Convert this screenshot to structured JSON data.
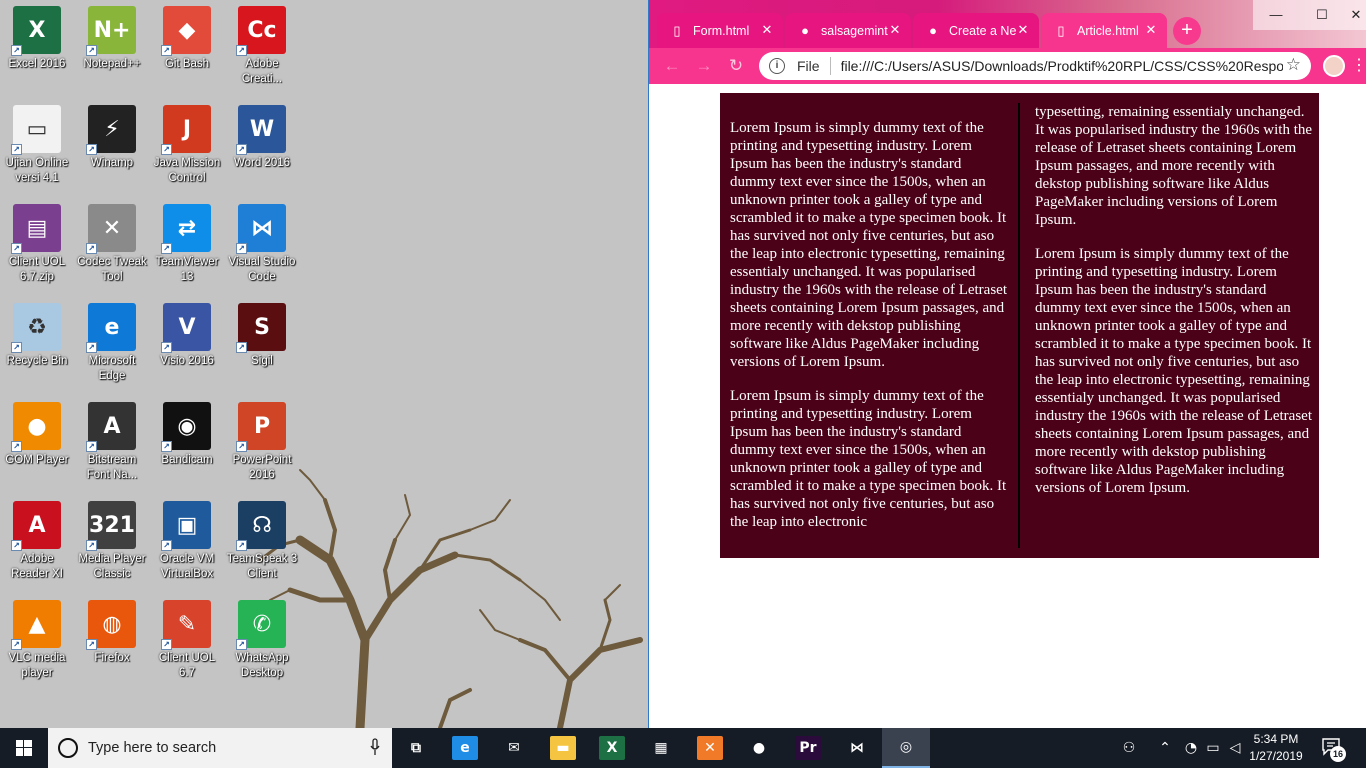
{
  "desktop": {
    "icons": [
      {
        "label": "Excel 2016",
        "glyph": "X",
        "icon": "excel-icon",
        "color": "#1d7044"
      },
      {
        "label": "Notepad++",
        "glyph": "N+",
        "icon": "notepadpp-icon",
        "color": "#89b63a"
      },
      {
        "label": "Git Bash",
        "glyph": "◆",
        "icon": "gitbash-icon",
        "color": "#e24a3a"
      },
      {
        "label": "Adobe Creati...",
        "glyph": "Cc",
        "icon": "adobe-cc-icon",
        "color": "#d7161d"
      },
      {
        "label": "Ujian Online versi 4.1",
        "glyph": "▭",
        "icon": "ujian-online-icon",
        "color": "#f2f2f2"
      },
      {
        "label": "Winamp",
        "glyph": "⚡",
        "icon": "winamp-icon",
        "color": "#222222"
      },
      {
        "label": "Java Mission Control",
        "glyph": "J",
        "icon": "java-mission-control-icon",
        "color": "#d23a20"
      },
      {
        "label": "Word 2016",
        "glyph": "W",
        "icon": "word-icon",
        "color": "#2b579a"
      },
      {
        "label": "Client UOL 6.7.zip",
        "glyph": "▤",
        "icon": "winrar-icon",
        "color": "#7a3f8f"
      },
      {
        "label": "Codec Tweak Tool",
        "glyph": "✕",
        "icon": "codec-tweak-icon",
        "color": "#8a8a8a"
      },
      {
        "label": "TeamViewer 13",
        "glyph": "⇄",
        "icon": "teamviewer-icon",
        "color": "#0e8ee9"
      },
      {
        "label": "Visual Studio Code",
        "glyph": "⋈",
        "icon": "vscode-icon",
        "color": "#1f7ed6"
      },
      {
        "label": "Recycle Bin",
        "glyph": "♻",
        "icon": "recycle-bin-icon",
        "color": "#a9c9e3"
      },
      {
        "label": "Microsoft Edge",
        "glyph": "e",
        "icon": "edge-icon",
        "color": "#0f79d7"
      },
      {
        "label": "Visio 2016",
        "glyph": "V",
        "icon": "visio-icon",
        "color": "#3955a3"
      },
      {
        "label": "Sigil",
        "glyph": "S",
        "icon": "sigil-icon",
        "color": "#5a0e10"
      },
      {
        "label": "GOM Player",
        "glyph": "●",
        "icon": "gom-player-icon",
        "color": "#f08a00"
      },
      {
        "label": "Bitstream Font Na...",
        "glyph": "A",
        "icon": "bitstream-icon",
        "color": "#333333"
      },
      {
        "label": "Bandicam",
        "glyph": "◉",
        "icon": "bandicam-icon",
        "color": "#111111"
      },
      {
        "label": "PowerPoint 2016",
        "glyph": "P",
        "icon": "powerpoint-icon",
        "color": "#d04525"
      },
      {
        "label": "Adobe Reader XI",
        "glyph": "A",
        "icon": "adobe-reader-icon",
        "color": "#c8101f"
      },
      {
        "label": "Media Player Classic",
        "glyph": "321",
        "icon": "media-player-classic-icon",
        "color": "#404040"
      },
      {
        "label": "Oracle VM VirtualBox",
        "glyph": "▣",
        "icon": "virtualbox-icon",
        "color": "#1e5a9c"
      },
      {
        "label": "TeamSpeak 3 Client",
        "glyph": "☊",
        "icon": "teamspeak-icon",
        "color": "#1b3f63"
      },
      {
        "label": "VLC media player",
        "glyph": "▲",
        "icon": "vlc-icon",
        "color": "#f07c00"
      },
      {
        "label": "Firefox",
        "glyph": "◍",
        "icon": "firefox-icon",
        "color": "#e8570c"
      },
      {
        "label": "Client UOL 6.7",
        "glyph": "✎",
        "icon": "client-uol-icon",
        "color": "#d8432b"
      },
      {
        "label": "WhatsApp Desktop",
        "glyph": "✆",
        "icon": "whatsapp-icon",
        "color": "#25b355"
      }
    ]
  },
  "browser": {
    "tabs": [
      {
        "title": "Form.html",
        "icon": "file-icon",
        "active": false
      },
      {
        "title": "salsagemint",
        "icon": "github-icon",
        "active": false
      },
      {
        "title": "Create a Ne",
        "icon": "github-icon",
        "active": false
      },
      {
        "title": "Article.html",
        "icon": "file-icon",
        "active": true
      }
    ],
    "new_tab": "+",
    "window": {
      "min": "—",
      "max": "☐",
      "close": "✕"
    },
    "omnibox": {
      "scheme": "File",
      "url": "file:///C:/Users/ASUS/Downloads/Prodktif%20RPL/CSS/CSS%20Respo..."
    },
    "accent": "#f7348e"
  },
  "article": {
    "background": "#4b0118",
    "col1": [
      "Lorem Ipsum is simply dummy text of the printing and typesetting industry. Lorem Ipsum has been the industry's standard dummy text ever since the 1500s, when an unknown printer took a galley of type and scrambled it to make a type specimen book. It has survived not only five centuries, but aso the leap into electronic typesetting, remaining essentialy unchanged. It was popularised industry the 1960s with the release of Letraset sheets containing Lorem Ipsum passages, and more recently with dekstop publishing software like Aldus PageMaker including versions of Lorem Ipsum.",
      "Lorem Ipsum is simply dummy text of the printing and typesetting industry. Lorem Ipsum has been the industry's standard dummy text ever since the 1500s, when an unknown printer took a galley of type and scrambled it to make a type specimen book. It has survived not only five centuries, but aso the leap into electronic"
    ],
    "col2": [
      "typesetting, remaining essentialy unchanged. It was popularised industry the 1960s with the release of Letraset sheets containing Lorem Ipsum passages, and more recently with dekstop publishing software like Aldus PageMaker including versions of Lorem Ipsum.",
      "Lorem Ipsum is simply dummy text of the printing and typesetting industry. Lorem Ipsum has been the industry's standard dummy text ever since the 1500s, when an unknown printer took a galley of type and scrambled it to make a type specimen book. It has survived not only five centuries, but aso the leap into electronic typesetting, remaining essentialy unchanged. It was popularised industry the 1960s with the release of Letraset sheets containing Lorem Ipsum passages, and more recently with dekstop publishing software like Aldus PageMaker including versions of Lorem Ipsum."
    ]
  },
  "taskbar": {
    "search_placeholder": "Type here to search",
    "apps": [
      {
        "name": "task-view",
        "glyph": "⧉",
        "color": "#161c25",
        "active": false
      },
      {
        "name": "edge",
        "glyph": "e",
        "color": "#1f8ce6",
        "active": false
      },
      {
        "name": "mail",
        "glyph": "✉",
        "color": "#161c25",
        "active": false
      },
      {
        "name": "file-explorer",
        "glyph": "▬",
        "color": "#f5c542",
        "active": false
      },
      {
        "name": "excel",
        "glyph": "X",
        "color": "#1d7044",
        "active": false
      },
      {
        "name": "store",
        "glyph": "▦",
        "color": "#161c25",
        "active": false
      },
      {
        "name": "xampp",
        "glyph": "✕",
        "color": "#f07a28",
        "active": false
      },
      {
        "name": "bandicam",
        "glyph": "●",
        "color": "#161c25",
        "active": false
      },
      {
        "name": "premiere",
        "glyph": "Pr",
        "color": "#2a0b3c",
        "active": false
      },
      {
        "name": "vscode",
        "glyph": "⋈",
        "color": "#161c25",
        "active": false
      },
      {
        "name": "chrome",
        "glyph": "◎",
        "color": "#3a4250",
        "active": true
      }
    ],
    "time": "5:34 PM",
    "date": "1/27/2019",
    "notifications": "16"
  }
}
